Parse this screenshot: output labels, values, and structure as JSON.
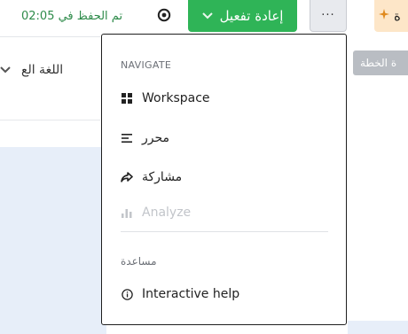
{
  "toolbar": {
    "saved_status": "تم الحفظ في 02:05",
    "reactivate_label": "إعادة تفعيل",
    "more_label": "···",
    "plan_label_partial": "ة",
    "tooltip_partial": "ة الخطة"
  },
  "left": {
    "language_label": "اللغة الع"
  },
  "menu": {
    "section_navigate": "NAVIGATE",
    "items": [
      {
        "label": "Workspace",
        "icon": "grid-icon",
        "disabled": false
      },
      {
        "label": "محرر",
        "icon": "align-icon",
        "disabled": false
      },
      {
        "label": "مشاركة",
        "icon": "share-icon",
        "disabled": false
      },
      {
        "label": "Analyze",
        "icon": "bar-chart-icon",
        "disabled": true
      }
    ],
    "section_help": "مساعدة",
    "help_item": {
      "label": "Interactive help",
      "icon": "info-icon"
    }
  },
  "colors": {
    "accent_green": "#2fb457",
    "saved_green": "#2e8b4a",
    "panel_blue": "#e7eef9",
    "plan_orange": "#fde6c8"
  }
}
